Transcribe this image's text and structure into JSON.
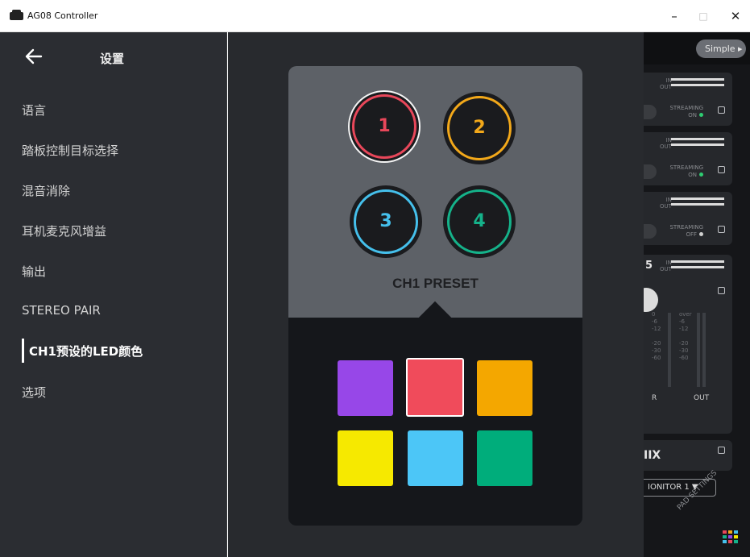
{
  "window": {
    "title": "AG08 Controller",
    "minimize": "–",
    "maximize": "□",
    "close": "✕"
  },
  "settings": {
    "title": "设置",
    "items": [
      {
        "label": "语言"
      },
      {
        "label": "踏板控制目标选择"
      },
      {
        "label": "混音消除"
      },
      {
        "label": "耳机麦克风增益"
      },
      {
        "label": "输出"
      },
      {
        "label": "STEREO PAIR"
      },
      {
        "label": "CH1预设的LED颜色",
        "active": true
      },
      {
        "label": "选项"
      }
    ]
  },
  "background_panel": {
    "mode_button": "Simple ▸",
    "io_in": "IN",
    "io_out": "OUT",
    "streaming": [
      {
        "label": "STREAMING",
        "state": "ON",
        "color": "#2ecc71"
      },
      {
        "label": "STREAMING",
        "state": "ON",
        "color": "#2ecc71"
      },
      {
        "label": "STREAMING",
        "state": "OFF",
        "color": "#d0d0d0"
      }
    ],
    "channel_partial": "5",
    "scale_left": [
      "0",
      "-6",
      "-12",
      "-20",
      "-30",
      "-60"
    ],
    "scale_right": [
      "over",
      "-6",
      "-12",
      "-20",
      "-30",
      "-60"
    ],
    "meter_r": "R",
    "meter_out": "OUT",
    "mix_label": "IIX",
    "monitor_select": "IONITOR 1  ▼",
    "pad_settings": "PAD SETTINGS"
  },
  "popup": {
    "preset_title": "CH1 PRESET",
    "pads": [
      {
        "number": "1",
        "color": "#e8475a",
        "selected": true
      },
      {
        "number": "2",
        "color": "#f2a81a",
        "selected": false
      },
      {
        "number": "3",
        "color": "#45c0ec",
        "selected": false
      },
      {
        "number": "4",
        "color": "#15b28a",
        "selected": false
      }
    ],
    "colors": [
      {
        "name": "purple",
        "hex": "#9747e8",
        "selected": false
      },
      {
        "name": "red",
        "hex": "#f04b5b",
        "selected": true
      },
      {
        "name": "orange",
        "hex": "#f4a700",
        "selected": false
      },
      {
        "name": "yellow",
        "hex": "#f6e900",
        "selected": false
      },
      {
        "name": "light-blue",
        "hex": "#4cc6f7",
        "selected": false
      },
      {
        "name": "green",
        "hex": "#00ad7b",
        "selected": false
      }
    ]
  }
}
